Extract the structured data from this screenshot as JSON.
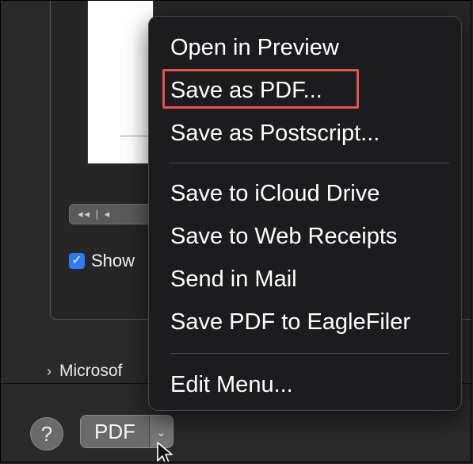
{
  "background": {
    "nav_control_label": "◂◂  |  ◂",
    "show_checkbox": {
      "checked": true,
      "label": "Show"
    },
    "microsoft_row": {
      "label": "Microsof"
    }
  },
  "footer": {
    "help_label": "?",
    "pdf_button": {
      "label": "PDF",
      "arrow": "⌄"
    }
  },
  "menu": {
    "items": [
      {
        "label": "Open in Preview"
      },
      {
        "label": "Save as PDF...",
        "highlighted": true
      },
      {
        "label": "Save as Postscript..."
      },
      {
        "label": "Save to iCloud Drive"
      },
      {
        "label": "Save to Web Receipts"
      },
      {
        "label": "Send in Mail"
      },
      {
        "label": "Save PDF to EagleFiler"
      },
      {
        "label": "Edit Menu..."
      }
    ]
  },
  "colors": {
    "highlight": "#e2554a",
    "checkbox": "#2f7bf5",
    "menu_background": "#1c1c1e"
  }
}
